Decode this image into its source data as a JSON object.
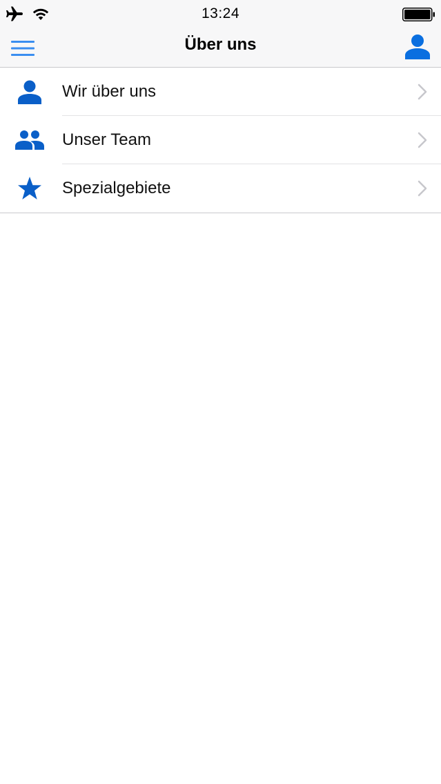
{
  "status_bar": {
    "time": "13:24",
    "airplane_icon": "airplane-icon",
    "wifi_icon": "wifi-icon",
    "battery_icon": "battery-icon"
  },
  "nav": {
    "title": "Über uns",
    "menu_icon": "hamburger-menu-icon",
    "user_icon": "user-icon"
  },
  "colors": {
    "accent": "#0a5fc8",
    "menu_accent": "#3a8ef0",
    "chevron": "#c7c7cc",
    "separator": "#e2e2e4",
    "bar_background": "#f7f7f8"
  },
  "list": {
    "items": [
      {
        "label": "Wir über uns",
        "icon": "person-icon"
      },
      {
        "label": "Unser Team",
        "icon": "group-icon"
      },
      {
        "label": "Spezialgebiete",
        "icon": "star-icon"
      }
    ]
  }
}
